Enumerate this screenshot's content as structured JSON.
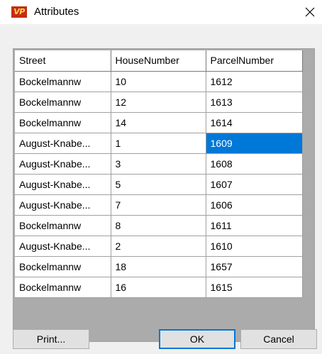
{
  "window": {
    "title": "Attributes",
    "app_icon_text": "VP",
    "close_glyph": "✕"
  },
  "grid": {
    "columns": [
      "Street",
      "HouseNumber",
      "ParcelNumber"
    ],
    "rows": [
      [
        "Bockelmannw",
        "10",
        "1612"
      ],
      [
        "Bockelmannw",
        "12",
        "1613"
      ],
      [
        "Bockelmannw",
        "14",
        "1614"
      ],
      [
        "August-Knabe...",
        "1",
        "1609"
      ],
      [
        "August-Knabe...",
        "3",
        "1608"
      ],
      [
        "August-Knabe...",
        "5",
        "1607"
      ],
      [
        "August-Knabe...",
        "7",
        "1606"
      ],
      [
        "Bockelmannw",
        "8",
        "1611"
      ],
      [
        "August-Knabe...",
        "2",
        "1610"
      ],
      [
        "Bockelmannw",
        "18",
        "1657"
      ],
      [
        "Bockelmannw",
        "16",
        "1615"
      ]
    ],
    "selected_cell": {
      "row": 3,
      "col": 2
    }
  },
  "buttons": {
    "print_label": "Print...",
    "ok_label": "OK",
    "cancel_label": "Cancel"
  },
  "colors": {
    "selection": "#0078d7",
    "grid_background": "#ababab",
    "dialog_background": "#f0f0f0",
    "icon_background": "#c62b12",
    "icon_text": "#ffd94a"
  }
}
